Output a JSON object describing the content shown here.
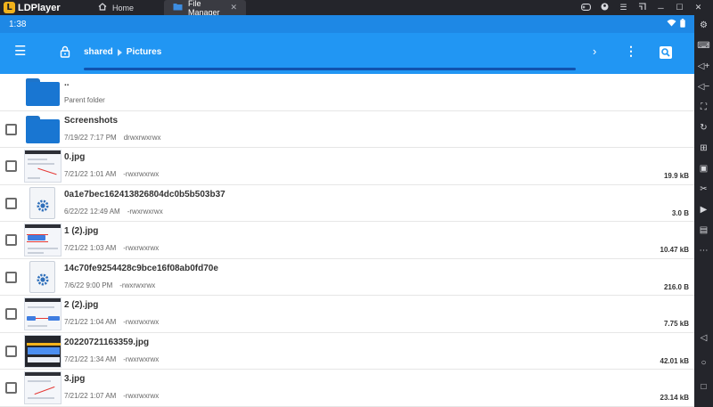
{
  "emulator": {
    "brand": "LDPlayer",
    "logo_letter": "L",
    "tabs": [
      {
        "label": "Home"
      },
      {
        "label": "File Manager"
      }
    ]
  },
  "status": {
    "time": "1:38"
  },
  "path": {
    "root": "shared",
    "current": "Pictures"
  },
  "rows": [
    {
      "name": "..",
      "date": "Parent folder",
      "perm": "",
      "size": ""
    },
    {
      "name": "Screenshots",
      "date": "7/19/22 7:17 PM",
      "perm": "drwxrwxrwx",
      "size": ""
    },
    {
      "name": "0.jpg",
      "date": "7/21/22 1:01 AM",
      "perm": "-rwxrwxrwx",
      "size": "19.9 kB"
    },
    {
      "name": "0a1e7bec162413826804dc0b5b503b37",
      "date": "6/22/22 12:49 AM",
      "perm": "-rwxrwxrwx",
      "size": "3.0 B"
    },
    {
      "name": "1 (2).jpg",
      "date": "7/21/22 1:03 AM",
      "perm": "-rwxrwxrwx",
      "size": "10.47 kB"
    },
    {
      "name": "14c70fe9254428c9bce16f08ab0fd70e",
      "date": "7/6/22 9:00 PM",
      "perm": "-rwxrwxrwx",
      "size": "216.0 B"
    },
    {
      "name": "2 (2).jpg",
      "date": "7/21/22 1:04 AM",
      "perm": "-rwxrwxrwx",
      "size": "7.75 kB"
    },
    {
      "name": "20220721163359.jpg",
      "date": "7/21/22 1:34 AM",
      "perm": "-rwxrwxrwx",
      "size": "42.01 kB"
    },
    {
      "name": "3.jpg",
      "date": "7/21/22 1:07 AM",
      "perm": "-rwxrwxrwx",
      "size": "23.14 kB"
    }
  ],
  "colors": {
    "appbar": "#2196f3",
    "statusbar": "#1e88e5",
    "folder": "#1976d2",
    "emulator_chrome": "#24252b"
  }
}
